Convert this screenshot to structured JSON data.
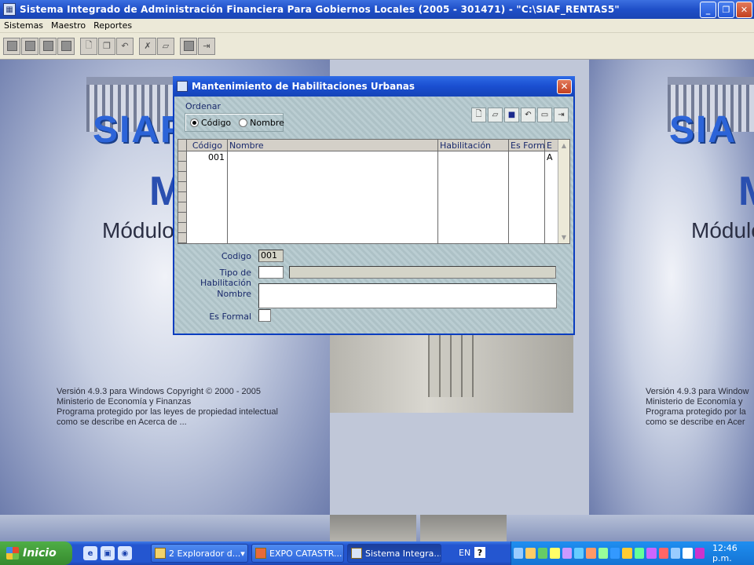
{
  "app": {
    "title": "Sistema Integrado de Administración Financiera Para Gobiernos Locales (2005 - 301471) - \"C:\\SIAF_RENTAS5\"",
    "minimize": "_",
    "restore": "❐",
    "close": "✕"
  },
  "menu": {
    "items": [
      "Sistemas",
      "Maestro",
      "Reportes"
    ]
  },
  "background": {
    "logo": "SIAF",
    "logo_partial": "SIA",
    "m_letter": "M",
    "modulo": "Módulo",
    "version_lines": "Versión 4.9.3 para Windows Copyright © 2000 - 2005\nMinisterio de Economía y Finanzas\nPrograma protegido por las leyes de propiedad intelectual\ncomo se describe en Acerca de ...",
    "version_lines_right": "Versión 4.9.3 para Window\nMinisterio de Economía y\nPrograma protegido por la\ncomo se describe en Acer"
  },
  "dialog": {
    "title": "Mantenimiento de Habilitaciones Urbanas",
    "close": "✕",
    "ordenar_label": "Ordenar",
    "radio_codigo": "Código",
    "radio_nombre": "Nombre",
    "selected_order": "Código",
    "grid": {
      "columns": [
        "Código",
        "Nombre",
        "Habilitación",
        "Es Formal",
        "E"
      ],
      "rows": [
        {
          "codigo": "001",
          "nombre": "",
          "habilitacion": "",
          "es_formal": "",
          "e": "A"
        }
      ]
    },
    "fields": {
      "codigo_label": "Codigo",
      "codigo_value": "001",
      "tipo_label": "Tipo de Habilitación",
      "tipo_value": "",
      "nombre_label": "Nombre",
      "nombre_value": "",
      "es_formal_label": "Es Formal"
    }
  },
  "taskbar": {
    "start": "Inicio",
    "tasks": [
      "2 Explorador d...",
      "EXPO CATASTR...",
      "Sistema Integra..."
    ],
    "lang": "EN",
    "help": "?",
    "clock": "12:46 p.m."
  }
}
